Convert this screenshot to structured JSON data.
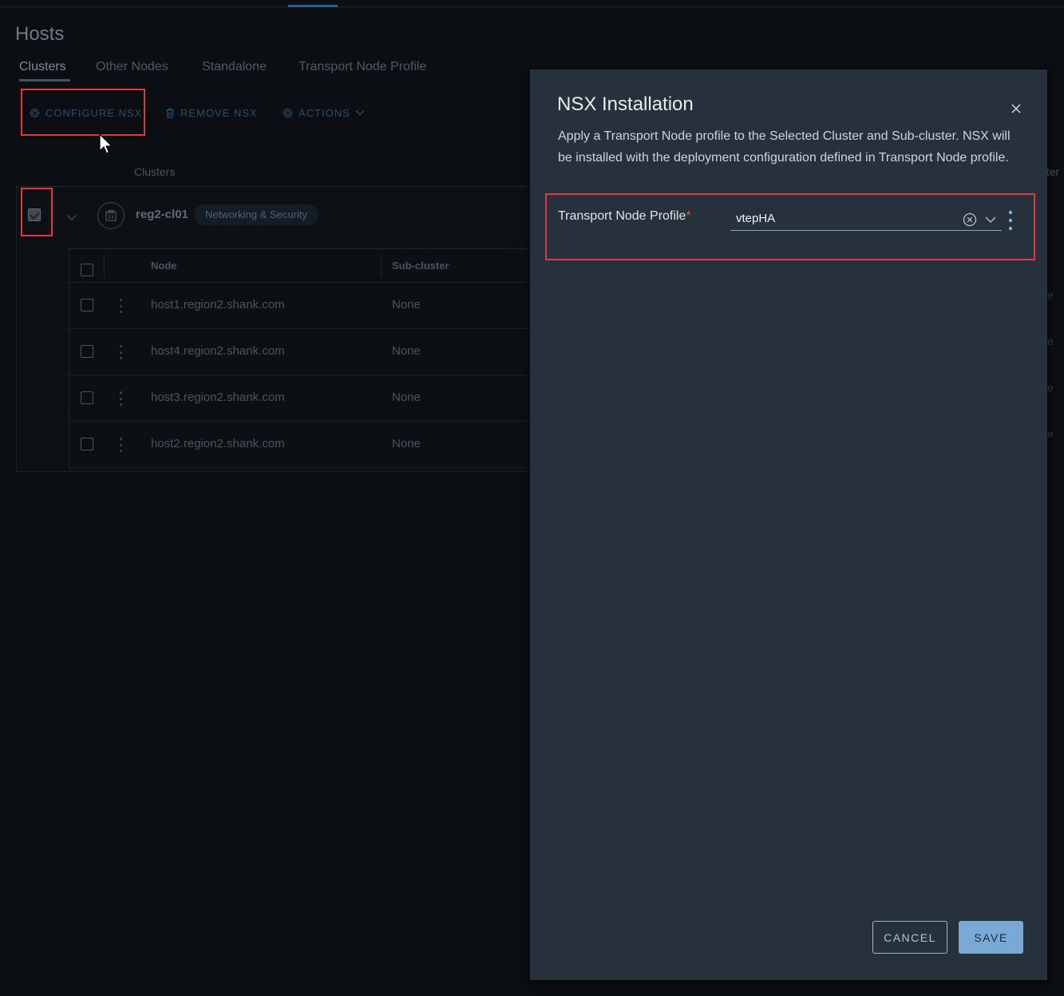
{
  "page": {
    "title": "Hosts"
  },
  "tabs": [
    {
      "label": "Clusters",
      "active": true
    },
    {
      "label": "Other Nodes"
    },
    {
      "label": "Standalone"
    },
    {
      "label": "Transport Node Profile"
    }
  ],
  "toolbar": {
    "configure_label": "CONFIGURE NSX",
    "remove_label": "REMOVE NSX",
    "actions_label": "ACTIONS"
  },
  "grid": {
    "col_clusters": "Clusters",
    "col_right_partial": "ter",
    "cluster": {
      "name": "reg2-cl01",
      "badge": "Networking & Security",
      "checked": true
    },
    "node_table": {
      "headers": {
        "node": "Node",
        "subcluster": "Sub-cluster"
      },
      "rows": [
        {
          "node": "host1.region2.shank.com",
          "subcluster": "None",
          "edge": "e"
        },
        {
          "node": "host4.region2.shank.com",
          "subcluster": "None",
          "edge": "e"
        },
        {
          "node": "host3.region2.shank.com",
          "subcluster": "None",
          "edge": "e"
        },
        {
          "node": "host2.region2.shank.com",
          "subcluster": "None",
          "edge": "e"
        }
      ]
    }
  },
  "modal": {
    "title": "NSX Installation",
    "description": "Apply a Transport Node profile to the Selected Cluster and Sub-cluster. NSX will be installed with the deployment configuration defined in Transport Node profile.",
    "field_label": "Transport Node Profile",
    "required_mark": "*",
    "selected_profile": "vtepHA",
    "cancel_label": "CANCEL",
    "save_label": "SAVE"
  },
  "icons": {
    "gear": "gear-icon",
    "trash": "trash-icon",
    "chevron": "chevron-down-icon",
    "close": "close-icon",
    "clear": "clear-circle-icon",
    "kebab": "kebab-icon",
    "cluster": "cluster-icon"
  },
  "colors": {
    "highlight": "#e0393e",
    "modal_bg": "#27313b",
    "primary_button": "#79aad6",
    "link_blue": "#2b4f6b"
  }
}
